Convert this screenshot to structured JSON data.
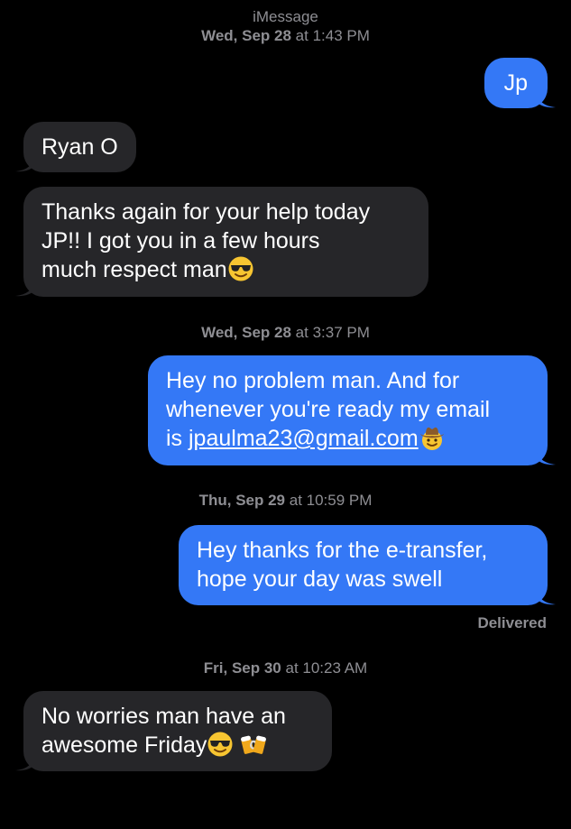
{
  "header": {
    "service": "iMessage",
    "date_day": "Wed, Sep 28",
    "date_time": " at 1:43 PM"
  },
  "messages": [
    {
      "text": "Jp"
    },
    {
      "text": "Ryan O"
    },
    {
      "line1": "Thanks again for your help today",
      "line2": "JP!! I got you in a few hours",
      "line3": "much respect man",
      "emoji": "smiling-face-with-sunglasses"
    },
    {
      "ts_day": "Wed, Sep 28",
      "ts_time": " at 3:37 PM"
    },
    {
      "line1": "Hey no problem man. And for",
      "line2": "whenever you're ready my email",
      "line3_prefix": "is ",
      "link": "jpaulma23@gmail.com",
      "emoji": "cowboy-hat-face"
    },
    {
      "ts_day": "Thu, Sep 29",
      "ts_time": " at 10:59 PM"
    },
    {
      "line1": "Hey thanks for the e-transfer,",
      "line2": "hope your day was swell"
    },
    {
      "ts_day": "Fri, Sep 30",
      "ts_time": " at 10:23 AM"
    },
    {
      "line1": "No worries man have an",
      "line2": "awesome Friday",
      "emoji1": "smiling-face-with-sunglasses",
      "emoji2": "clinking-beer-mugs"
    }
  ],
  "status": {
    "delivered": "Delivered"
  },
  "colors": {
    "background": "#000000",
    "incoming_bubble": "#262629",
    "outgoing_bubble": "#3478f6",
    "meta_text": "#8e8e93"
  }
}
